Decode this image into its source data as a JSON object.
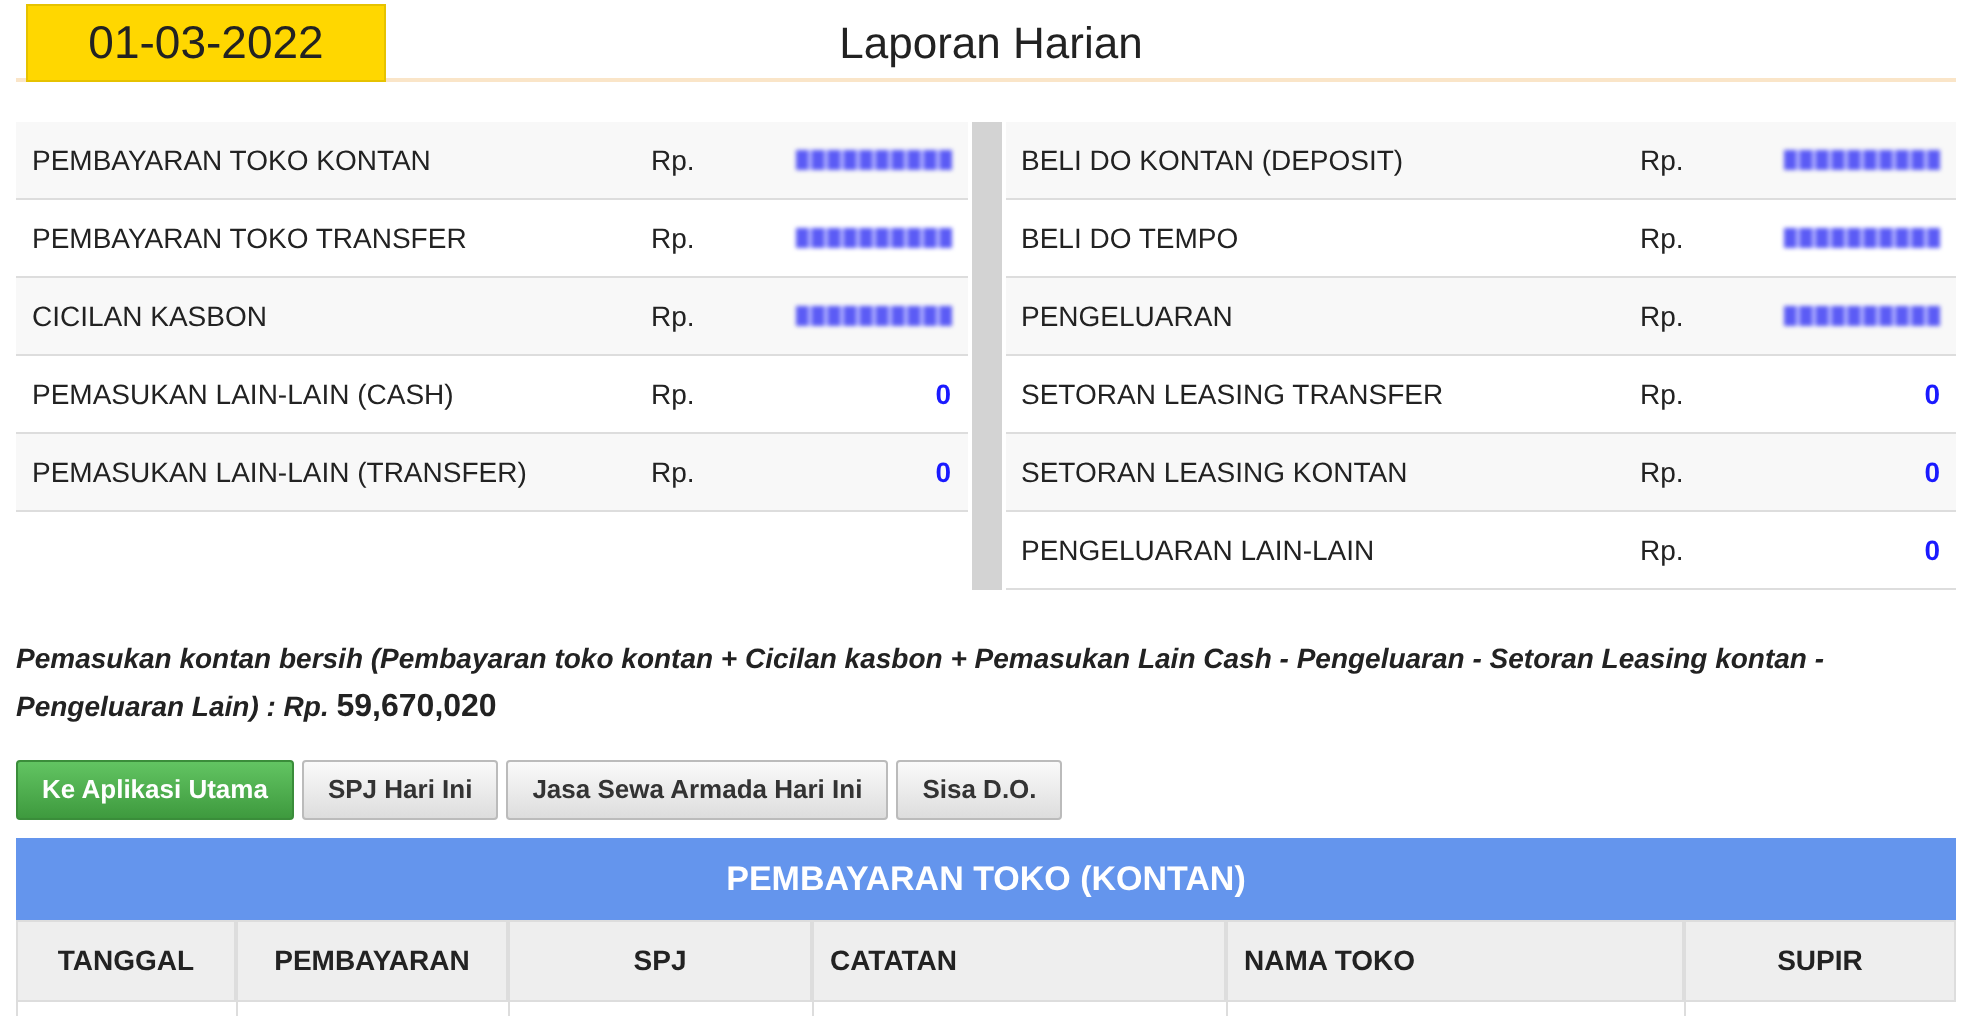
{
  "header": {
    "date": "01-03-2022",
    "title": "Laporan Harian"
  },
  "summary_left": [
    {
      "label": "PEMBAYARAN TOKO KONTAN",
      "currency": "Rp.",
      "kind": "redacted"
    },
    {
      "label": "PEMBAYARAN TOKO TRANSFER",
      "currency": "Rp.",
      "kind": "redacted"
    },
    {
      "label": "CICILAN KASBON",
      "currency": "Rp.",
      "kind": "redacted"
    },
    {
      "label": "PEMASUKAN LAIN-LAIN (CASH)",
      "currency": "Rp.",
      "kind": "value",
      "value": "0"
    },
    {
      "label": "PEMASUKAN LAIN-LAIN (TRANSFER)",
      "currency": "Rp.",
      "kind": "value",
      "value": "0"
    }
  ],
  "summary_right": [
    {
      "label": "BELI DO KONTAN (DEPOSIT)",
      "currency": "Rp.",
      "kind": "redacted"
    },
    {
      "label": "BELI DO TEMPO",
      "currency": "Rp.",
      "kind": "redacted"
    },
    {
      "label": "PENGELUARAN",
      "currency": "Rp.",
      "kind": "redacted"
    },
    {
      "label": "SETORAN LEASING TRANSFER",
      "currency": "Rp.",
      "kind": "value",
      "value": "0"
    },
    {
      "label": "SETORAN LEASING KONTAN",
      "currency": "Rp.",
      "kind": "value",
      "value": "0"
    },
    {
      "label": "PENGELUARAN LAIN-LAIN",
      "currency": "Rp.",
      "kind": "value",
      "value": "0"
    }
  ],
  "net_cash": {
    "formula": "Pemasukan kontan bersih (Pembayaran toko kontan + Cicilan kasbon + Pemasukan Lain Cash - Pengeluaran - Setoran Leasing kontan - Pengeluaran Lain) : Rp.",
    "amount": "59,670,020"
  },
  "buttons": [
    {
      "label": "Ke Aplikasi Utama",
      "kind": "primary"
    },
    {
      "label": "SPJ Hari Ini",
      "kind": "default"
    },
    {
      "label": "Jasa Sewa Armada Hari Ini",
      "kind": "default"
    },
    {
      "label": "Sisa D.O.",
      "kind": "default"
    }
  ],
  "table": {
    "title": "PEMBAYARAN TOKO (KONTAN)",
    "columns": [
      "TANGGAL",
      "PEMBAYARAN",
      "SPJ",
      "CATATAN",
      "NAMA TOKO",
      "SUPIR"
    ]
  }
}
